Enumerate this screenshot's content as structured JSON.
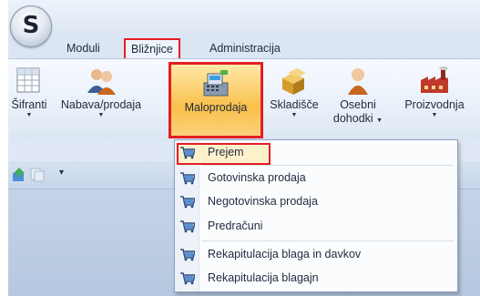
{
  "app": {
    "logo_letter": "S"
  },
  "menu_tabs": [
    {
      "label": "Moduli",
      "selected": false
    },
    {
      "label": "Bližnjice",
      "selected": true
    },
    {
      "label": "Administracija",
      "selected": false
    }
  ],
  "ribbon": {
    "buttons": [
      {
        "label": "Šifranti",
        "icon": "table-grid-icon",
        "has_dropdown": true
      },
      {
        "label": "Nabava/prodaja",
        "icon": "people-icon",
        "has_dropdown": true
      },
      {
        "label": "Maloprodaja",
        "icon": "cash-register-icon",
        "has_dropdown": false,
        "active": true
      },
      {
        "label": "Skladišče",
        "icon": "boxes-icon",
        "has_dropdown": true
      },
      {
        "label": "Osebni",
        "label2": "dohodki",
        "icon": "person-icon",
        "has_dropdown": true
      },
      {
        "label": "Proizvodnja",
        "icon": "factory-icon",
        "has_dropdown": true
      }
    ]
  },
  "dropdown": {
    "items": [
      {
        "label": "Prejem",
        "icon": "cart-icon",
        "highlighted": true
      },
      {
        "label": "Gotovinska prodaja",
        "icon": "cart-icon"
      },
      {
        "label": "Negotovinska prodaja",
        "icon": "cart-icon"
      },
      {
        "label": "Predračuni",
        "icon": "cart-icon"
      },
      {
        "label": "Rekapitulacija blaga in davkov",
        "icon": "cart-icon"
      },
      {
        "label": "Rekapitulacija blagajn",
        "icon": "cart-icon"
      }
    ]
  },
  "colors": {
    "highlight_border": "#e31e24",
    "accent": "#f9c04c",
    "ribbon_bg": "#e9f0f9"
  }
}
